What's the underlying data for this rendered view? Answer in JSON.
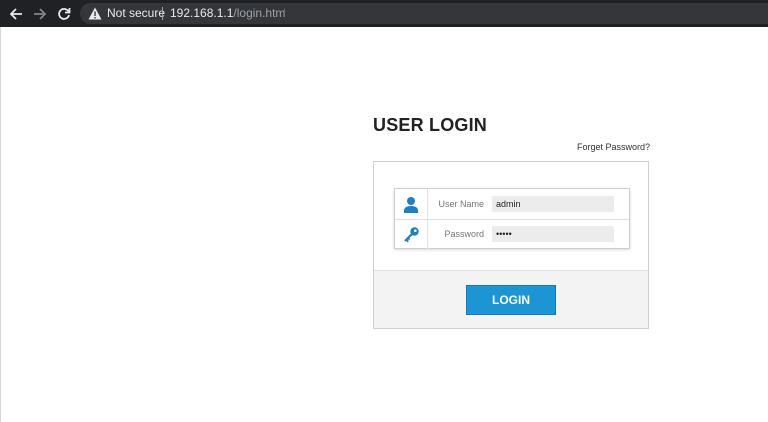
{
  "browser": {
    "security_label": "Not secure",
    "url_host": "192.168.1.1",
    "url_path": "/login.htm"
  },
  "login": {
    "title": "USER LOGIN",
    "forget_password": "Forget Password?",
    "username_label": "User Name",
    "username_value": "admin",
    "password_label": "Password",
    "password_value": "•••••",
    "button_label": "LOGIN"
  },
  "colors": {
    "chrome_bg": "#202124",
    "accent": "#1d95d4",
    "icon": "#1f7fbf"
  },
  "icons": [
    "back-arrow-icon",
    "forward-arrow-icon",
    "reload-icon",
    "warning-icon",
    "user-icon",
    "key-icon"
  ]
}
